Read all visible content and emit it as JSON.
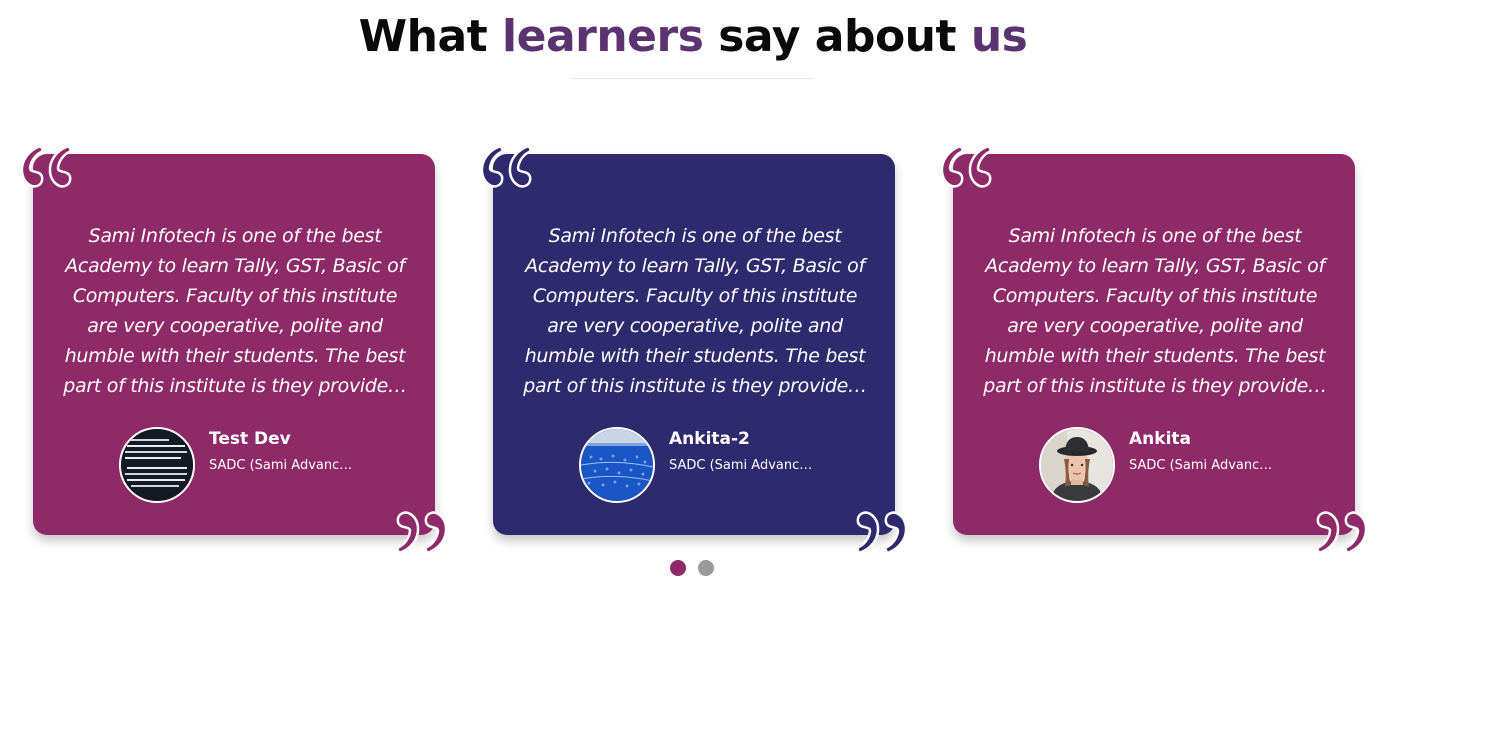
{
  "section": {
    "title_parts": [
      "What ",
      "learners",
      " say about ",
      "us"
    ]
  },
  "colors": {
    "magenta": "#8e2a67",
    "navy": "#2d2a6e",
    "accent_text": "#5a3370",
    "dot_active": "#8e2a67",
    "dot_inactive": "#9a9a9a"
  },
  "testimonials": [
    {
      "review": "Sami Infotech is one of the best Academy to learn Tally, GST, Basic of Computers. Faculty of this institute are very cooperative, polite and humble with their students. The best part of this institute is they provide…",
      "name": "Test Dev",
      "org": "SADC (Sami Advanc…",
      "avatar_icon": "code-screen-avatar",
      "card_color": "magenta"
    },
    {
      "review": "Sami Infotech is one of the best Academy to learn Tally, GST, Basic of Computers. Faculty of this institute are very cooperative, polite and humble with their students. The best part of this institute is they provide…",
      "name": "Ankita-2",
      "org": "SADC (Sami Advanc…",
      "avatar_icon": "blue-pattern-avatar",
      "card_color": "navy"
    },
    {
      "review": "Sami Infotech is one of the best Academy to learn Tally, GST, Basic of Computers. Faculty of this institute are very cooperative, polite and humble with their students. The best part of this institute is they provide…",
      "name": "Ankita",
      "org": "SADC (Sami Advanc…",
      "avatar_icon": "woman-portrait-avatar",
      "card_color": "magenta"
    }
  ],
  "pagination": {
    "dots": [
      "page-1",
      "page-2"
    ],
    "active_index": 0
  }
}
